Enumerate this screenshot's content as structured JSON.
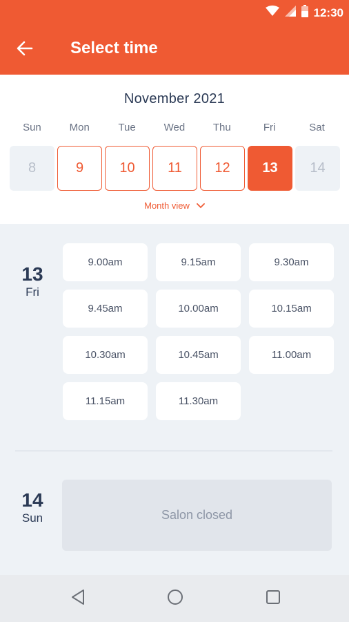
{
  "status_bar": {
    "time": "12:30",
    "icons": [
      "wifi-icon",
      "signal-icon",
      "battery-icon"
    ]
  },
  "app_bar": {
    "back_icon": "arrow-left-icon",
    "title": "Select time"
  },
  "calendar": {
    "month": "November 2021",
    "weekdays": [
      "Sun",
      "Mon",
      "Tue",
      "Wed",
      "Thu",
      "Fri",
      "Sat"
    ],
    "days": [
      {
        "num": "8",
        "state": "disabled"
      },
      {
        "num": "9",
        "state": "available"
      },
      {
        "num": "10",
        "state": "available"
      },
      {
        "num": "11",
        "state": "available"
      },
      {
        "num": "12",
        "state": "available"
      },
      {
        "num": "13",
        "state": "selected"
      },
      {
        "num": "14",
        "state": "disabled"
      }
    ],
    "month_view_label": "Month view",
    "month_view_icon": "chevron-down-icon"
  },
  "schedule": [
    {
      "day_num": "13",
      "day_name": "Fri",
      "slots": [
        "9.00am",
        "9.15am",
        "9.30am",
        "9.45am",
        "10.00am",
        "10.15am",
        "10.30am",
        "10.45am",
        "11.00am",
        "11.15am",
        "11.30am"
      ]
    },
    {
      "day_num": "14",
      "day_name": "Sun",
      "closed_text": "Salon closed"
    }
  ],
  "nav_bar": {
    "buttons": [
      "back-triangle-icon",
      "home-circle-icon",
      "recents-square-icon"
    ]
  },
  "colors": {
    "accent": "#ef5a33",
    "text_dark": "#2b3a55",
    "background": "#eef2f6"
  }
}
